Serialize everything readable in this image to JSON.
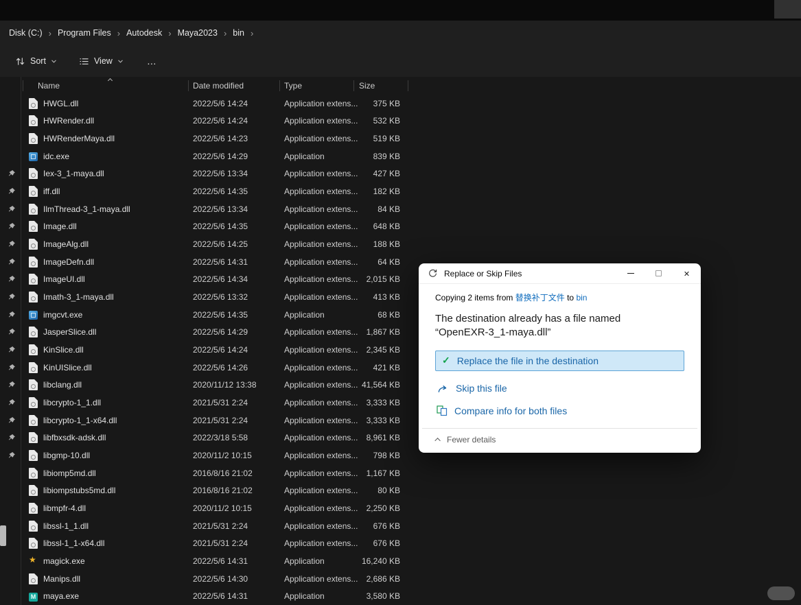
{
  "breadcrumb": {
    "items": [
      "Disk (C:)",
      "Program Files",
      "Autodesk",
      "Maya2023",
      "bin"
    ]
  },
  "toolbar": {
    "sort_label": "Sort",
    "view_label": "View",
    "more_label": "…"
  },
  "columns": {
    "name": "Name",
    "date_modified": "Date modified",
    "type": "Type",
    "size": "Size"
  },
  "files": [
    {
      "name": "HWGL.dll",
      "date": "2022/5/6 14:24",
      "type": "Application extens...",
      "size": "375 KB",
      "icon": "dll",
      "pinned": false
    },
    {
      "name": "HWRender.dll",
      "date": "2022/5/6 14:24",
      "type": "Application extens...",
      "size": "532 KB",
      "icon": "dll",
      "pinned": false
    },
    {
      "name": "HWRenderMaya.dll",
      "date": "2022/5/6 14:23",
      "type": "Application extens...",
      "size": "519 KB",
      "icon": "dll",
      "pinned": false
    },
    {
      "name": "idc.exe",
      "date": "2022/5/6 14:29",
      "type": "Application",
      "size": "839 KB",
      "icon": "exe",
      "pinned": false
    },
    {
      "name": "Iex-3_1-maya.dll",
      "date": "2022/5/6 13:34",
      "type": "Application extens...",
      "size": "427 KB",
      "icon": "dll",
      "pinned": true
    },
    {
      "name": "iff.dll",
      "date": "2022/5/6 14:35",
      "type": "Application extens...",
      "size": "182 KB",
      "icon": "dll",
      "pinned": true
    },
    {
      "name": "IlmThread-3_1-maya.dll",
      "date": "2022/5/6 13:34",
      "type": "Application extens...",
      "size": "84 KB",
      "icon": "dll",
      "pinned": true
    },
    {
      "name": "Image.dll",
      "date": "2022/5/6 14:35",
      "type": "Application extens...",
      "size": "648 KB",
      "icon": "dll",
      "pinned": true
    },
    {
      "name": "ImageAlg.dll",
      "date": "2022/5/6 14:25",
      "type": "Application extens...",
      "size": "188 KB",
      "icon": "dll",
      "pinned": true
    },
    {
      "name": "ImageDefn.dll",
      "date": "2022/5/6 14:31",
      "type": "Application extens...",
      "size": "64 KB",
      "icon": "dll",
      "pinned": true
    },
    {
      "name": "ImageUI.dll",
      "date": "2022/5/6 14:34",
      "type": "Application extens...",
      "size": "2,015 KB",
      "icon": "dll",
      "pinned": true
    },
    {
      "name": "Imath-3_1-maya.dll",
      "date": "2022/5/6 13:32",
      "type": "Application extens...",
      "size": "413 KB",
      "icon": "dll",
      "pinned": true
    },
    {
      "name": "imgcvt.exe",
      "date": "2022/5/6 14:35",
      "type": "Application",
      "size": "68 KB",
      "icon": "exe",
      "pinned": true
    },
    {
      "name": "JasperSlice.dll",
      "date": "2022/5/6 14:29",
      "type": "Application extens...",
      "size": "1,867 KB",
      "icon": "dll",
      "pinned": true
    },
    {
      "name": "KinSlice.dll",
      "date": "2022/5/6 14:24",
      "type": "Application extens...",
      "size": "2,345 KB",
      "icon": "dll",
      "pinned": true
    },
    {
      "name": "KinUISlice.dll",
      "date": "2022/5/6 14:26",
      "type": "Application extens...",
      "size": "421 KB",
      "icon": "dll",
      "pinned": true
    },
    {
      "name": "libclang.dll",
      "date": "2020/11/12 13:38",
      "type": "Application extens...",
      "size": "41,564 KB",
      "icon": "dll",
      "pinned": true
    },
    {
      "name": "libcrypto-1_1.dll",
      "date": "2021/5/31 2:24",
      "type": "Application extens...",
      "size": "3,333 KB",
      "icon": "dll",
      "pinned": true
    },
    {
      "name": "libcrypto-1_1-x64.dll",
      "date": "2021/5/31 2:24",
      "type": "Application extens...",
      "size": "3,333 KB",
      "icon": "dll",
      "pinned": true
    },
    {
      "name": "libfbxsdk-adsk.dll",
      "date": "2022/3/18 5:58",
      "type": "Application extens...",
      "size": "8,961 KB",
      "icon": "dll",
      "pinned": true
    },
    {
      "name": "libgmp-10.dll",
      "date": "2020/11/2 10:15",
      "type": "Application extens...",
      "size": "798 KB",
      "icon": "dll",
      "pinned": true
    },
    {
      "name": "libiomp5md.dll",
      "date": "2016/8/16 21:02",
      "type": "Application extens...",
      "size": "1,167 KB",
      "icon": "dll",
      "pinned": false
    },
    {
      "name": "libiompstubs5md.dll",
      "date": "2016/8/16 21:02",
      "type": "Application extens...",
      "size": "80 KB",
      "icon": "dll",
      "pinned": false
    },
    {
      "name": "libmpfr-4.dll",
      "date": "2020/11/2 10:15",
      "type": "Application extens...",
      "size": "2,250 KB",
      "icon": "dll",
      "pinned": false
    },
    {
      "name": "libssl-1_1.dll",
      "date": "2021/5/31 2:24",
      "type": "Application extens...",
      "size": "676 KB",
      "icon": "dll",
      "pinned": false
    },
    {
      "name": "libssl-1_1-x64.dll",
      "date": "2021/5/31 2:24",
      "type": "Application extens...",
      "size": "676 KB",
      "icon": "dll",
      "pinned": false
    },
    {
      "name": "magick.exe",
      "date": "2022/5/6 14:31",
      "type": "Application",
      "size": "16,240 KB",
      "icon": "magick",
      "pinned": false
    },
    {
      "name": "Manips.dll",
      "date": "2022/5/6 14:30",
      "type": "Application extens...",
      "size": "2,686 KB",
      "icon": "dll",
      "pinned": false
    },
    {
      "name": "maya.exe",
      "date": "2022/5/6 14:31",
      "type": "Application",
      "size": "3,580 KB",
      "icon": "maya",
      "pinned": false
    }
  ],
  "dialog": {
    "title": "Replace or Skip Files",
    "copy_line": {
      "prefix": "Copying 2 items from",
      "source": "替换补丁文件",
      "middle": "to",
      "dest": "bin"
    },
    "message_line1": "The destination already has a file named",
    "message_line2": "“OpenEXR-3_1-maya.dll”",
    "replace_option": "Replace the file in the destination",
    "skip_option": "Skip this file",
    "compare_option": "Compare info for both files",
    "fewer_details": "Fewer details"
  },
  "colors": {
    "accent_blue": "#1a66a8",
    "link_blue": "#0f6cbd",
    "highlight_fill": "#cfe8f8",
    "highlight_border": "#5ea4d6",
    "check_green": "#10a24a",
    "window_bg": "#181818",
    "bar_bg": "#1f1f1f"
  }
}
